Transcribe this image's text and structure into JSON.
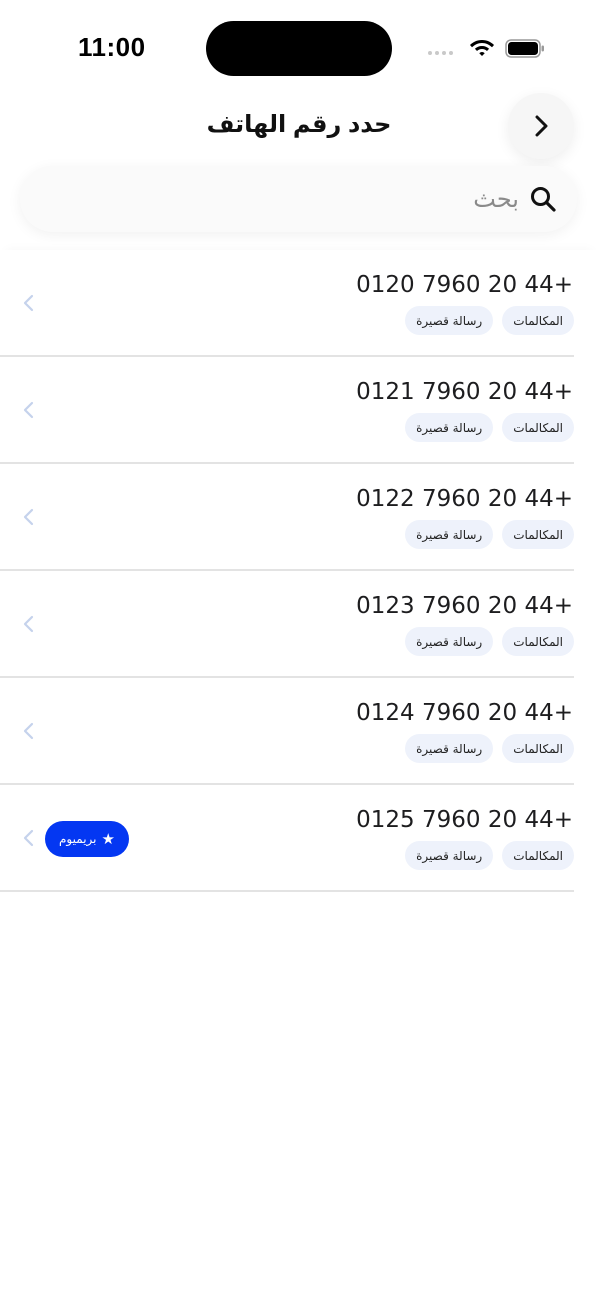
{
  "status_bar": {
    "time": "11:00"
  },
  "header": {
    "title": "حدد رقم الهاتف",
    "back_icon": "chevron-right-icon"
  },
  "search": {
    "placeholder": "بحث",
    "value": "",
    "icon": "search-icon"
  },
  "chips": {
    "calls": "المكالمات",
    "sms": "رسالة قصيرة"
  },
  "premium": {
    "label": "بريميوم",
    "star": "★"
  },
  "numbers": [
    {
      "number": "+44 20 7960 0120"
    },
    {
      "number": "+44 20 7960 0121"
    },
    {
      "number": "+44 20 7960 0122"
    },
    {
      "number": "+44 20 7960 0123"
    },
    {
      "number": "+44 20 7960 0124"
    },
    {
      "number": "+44 20 7960 0125"
    }
  ],
  "colors": {
    "accent": "#0437f2",
    "chip_bg": "#eef2fb",
    "chevron": "#c5d2ec",
    "divider": "#e3e3e3"
  }
}
